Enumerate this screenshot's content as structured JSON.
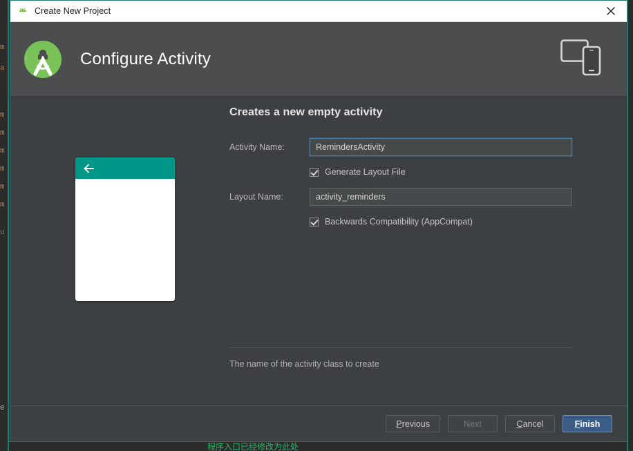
{
  "window": {
    "title": "Create New Project",
    "title_icon": "android-head-icon",
    "close_icon": "close-icon"
  },
  "header": {
    "title": "Configure Activity",
    "logo_icon": "android-studio-logo",
    "device_icon": "tablet-and-phone-icon"
  },
  "preview": {
    "back_arrow_icon": "arrow-back-icon",
    "appbar_color": "#009688",
    "screen_color": "#ffffff"
  },
  "form": {
    "section_title": "Creates a new empty activity",
    "activity_name": {
      "label": "Activity Name:",
      "value": "RemindersActivity",
      "focused": true
    },
    "generate_layout": {
      "label": "Generate Layout File",
      "checked": true
    },
    "layout_name": {
      "label": "Layout Name:",
      "value": "activity_reminders",
      "focused": false
    },
    "backwards_compat": {
      "label": "Backwards Compatibility (AppCompat)",
      "checked": true
    },
    "help_text": "The name of the activity class to create"
  },
  "footer": {
    "previous": {
      "label": "Previous",
      "mnemonic": "P",
      "disabled": false
    },
    "next": {
      "label": "Next",
      "mnemonic": "N",
      "disabled": true
    },
    "cancel": {
      "label": "Cancel",
      "mnemonic": "C",
      "disabled": false
    },
    "finish": {
      "label": "Finish",
      "mnemonic": "F",
      "primary": true
    }
  },
  "backdrop": {
    "gutter_lines": [
      "m",
      "a",
      "",
      "m",
      "m",
      "m",
      "m",
      "m",
      "m",
      "",
      "u",
      "",
      "",
      "",
      "",
      "",
      "e"
    ],
    "bottom_text": "程序入口已经修改为此处",
    "accent_color": "#1f7a74"
  },
  "colors": {
    "dialog_bg": "#3c4043",
    "header_bg": "#4b4d4f",
    "titlebar_bg": "#ffffff",
    "accent_teal": "#1f7a74",
    "primary_button": "#3b5c87",
    "appbar_teal": "#009688",
    "logo_green": "#78c257"
  }
}
